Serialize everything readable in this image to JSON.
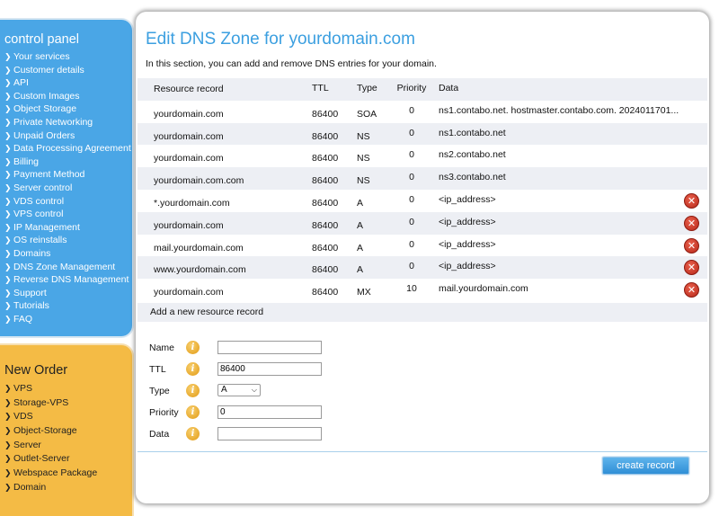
{
  "sidebar": {
    "title": "control panel",
    "items": [
      {
        "label": "Your services"
      },
      {
        "label": "Customer details"
      },
      {
        "label": "API"
      },
      {
        "label": "Custom Images"
      },
      {
        "label": "Object Storage"
      },
      {
        "label": "Private Networking"
      },
      {
        "label": "Unpaid Orders"
      },
      {
        "label": "Data Processing Agreement"
      },
      {
        "label": "Billing"
      },
      {
        "label": "Payment Method"
      },
      {
        "label": "Server control"
      },
      {
        "label": "VDS control"
      },
      {
        "label": "VPS control"
      },
      {
        "label": "IP Management"
      },
      {
        "label": "OS reinstalls"
      },
      {
        "label": "Domains"
      },
      {
        "label": "DNS Zone Management"
      },
      {
        "label": "Reverse DNS Management"
      },
      {
        "label": "Support"
      },
      {
        "label": "Tutorials"
      },
      {
        "label": "FAQ"
      }
    ]
  },
  "new_order": {
    "title": "New Order",
    "items": [
      {
        "label": "VPS"
      },
      {
        "label": "Storage-VPS"
      },
      {
        "label": "VDS"
      },
      {
        "label": "Object-Storage"
      },
      {
        "label": "Server"
      },
      {
        "label": "Outlet-Server"
      },
      {
        "label": "Webspace Package"
      },
      {
        "label": "Domain"
      }
    ]
  },
  "main": {
    "title": "Edit DNS Zone for yourdomain.com",
    "intro": "In this section, you can add and remove DNS entries for your domain.",
    "columns": {
      "record": "Resource record",
      "ttl": "TTL",
      "type": "Type",
      "priority": "Priority",
      "data": "Data"
    },
    "rows": [
      {
        "record": "yourdomain.com",
        "ttl": "86400",
        "type": "SOA",
        "priority": "0",
        "data": "ns1.contabo.net. hostmaster.contabo.com. 2024011701..."
      },
      {
        "record": "yourdomain.com",
        "ttl": "86400",
        "type": "NS",
        "priority": "0",
        "data": "ns1.contabo.net"
      },
      {
        "record": "yourdomain.com",
        "ttl": "86400",
        "type": "NS",
        "priority": "0",
        "data": "ns2.contabo.net"
      },
      {
        "record": "yourdomain.com.com",
        "ttl": "86400",
        "type": "NS",
        "priority": "0",
        "data": "ns3.contabo.net"
      },
      {
        "record": "*.yourdomain.com",
        "ttl": "86400",
        "type": "A",
        "priority": "0",
        "data": "<ip_address>"
      },
      {
        "record": "yourdomain.com",
        "ttl": "86400",
        "type": "A",
        "priority": "0",
        "data": "<ip_address>"
      },
      {
        "record": "mail.yourdomain.com",
        "ttl": "86400",
        "type": "A",
        "priority": "0",
        "data": "<ip_address>"
      },
      {
        "record": "www.yourdomain.com",
        "ttl": "86400",
        "type": "A",
        "priority": "0",
        "data": "<ip_address>"
      },
      {
        "record": "yourdomain.com",
        "ttl": "86400",
        "type": "MX",
        "priority": "10",
        "data": "mail.yourdomain.com"
      }
    ],
    "delete_icon": "delete-icon",
    "add_section": {
      "title": "Add a new resource record",
      "fields": {
        "name": {
          "label": "Name",
          "value": ""
        },
        "ttl": {
          "label": "TTL",
          "value": "86400"
        },
        "type": {
          "label": "Type",
          "value": "A"
        },
        "priority": {
          "label": "Priority",
          "value": "0"
        },
        "data": {
          "label": "Data",
          "value": ""
        }
      },
      "info_icon": "info-icon",
      "submit_label": "create record"
    }
  },
  "colors": {
    "sidebar_blue": "#4aa6e6",
    "new_order_orange": "#f4bb45",
    "title_blue": "#3b9fe0",
    "row_alt": "#edeff4",
    "delete_red": "#c8321f",
    "button_blue": "#3d9ae0"
  }
}
